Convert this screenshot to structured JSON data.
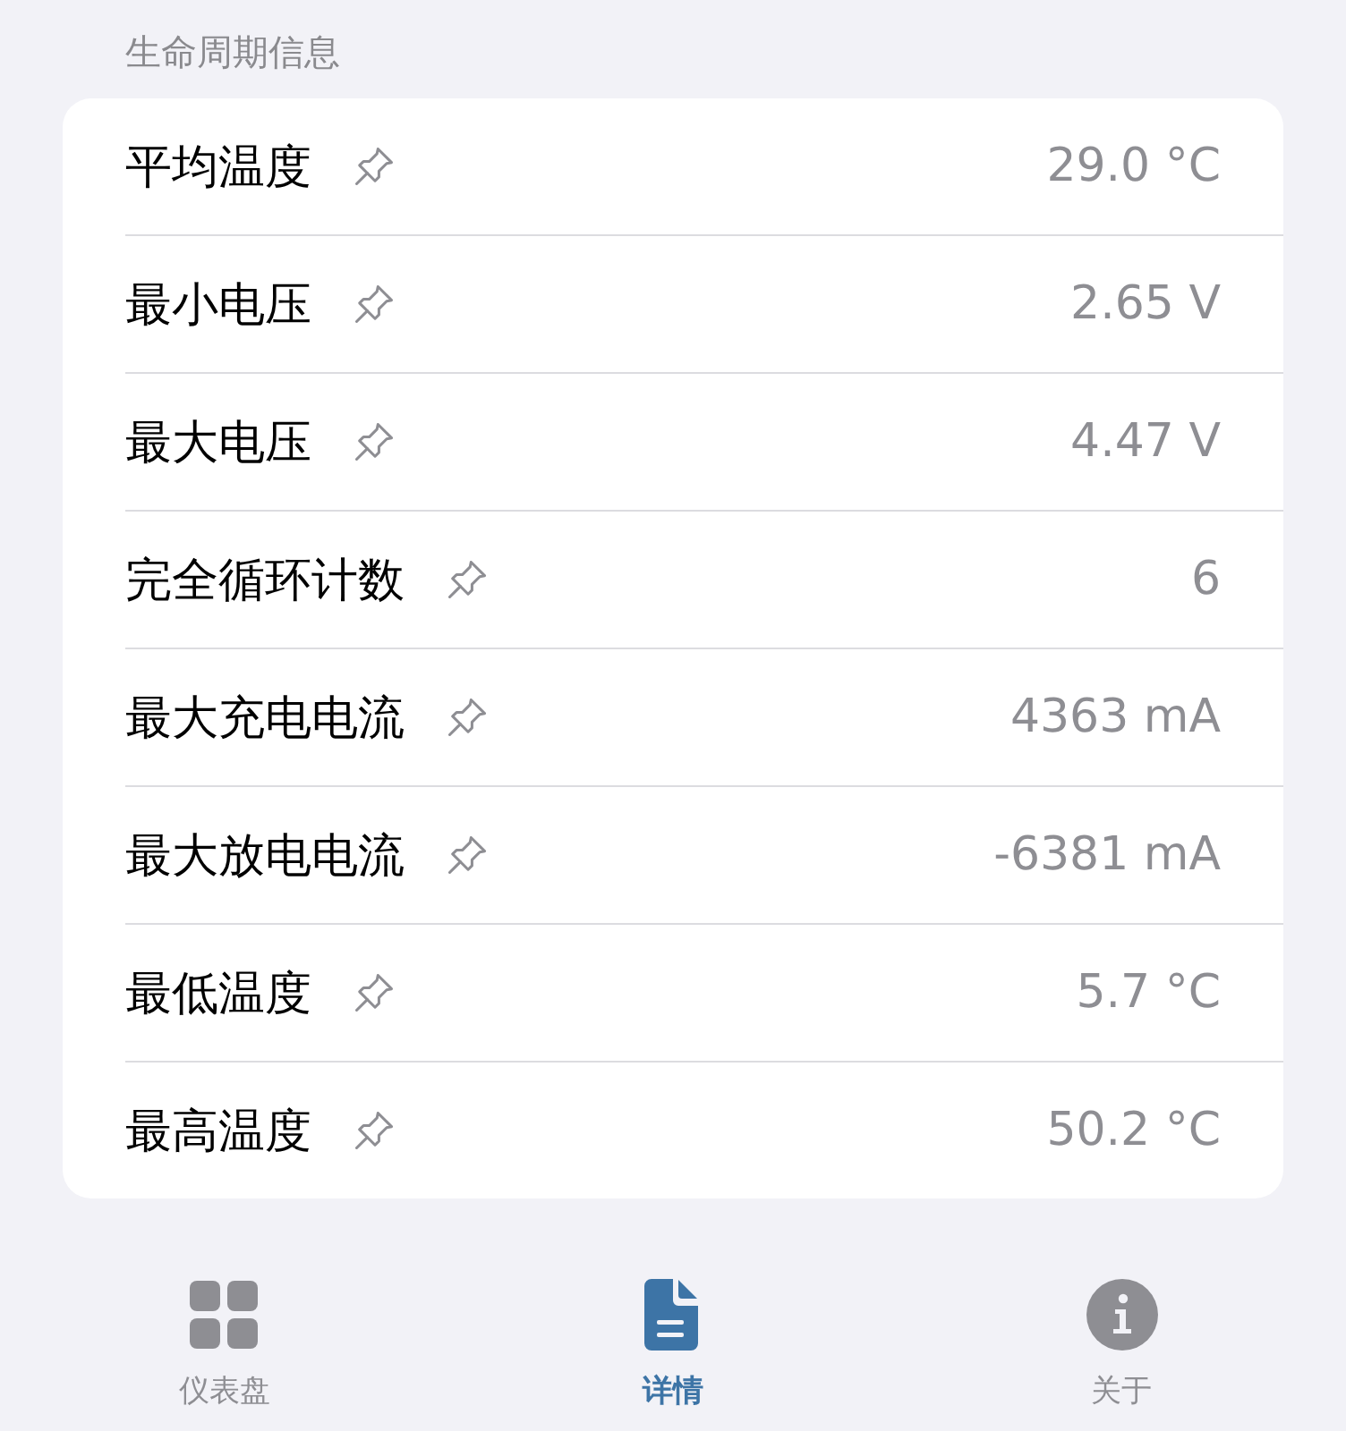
{
  "section_title": "生命周期信息",
  "rows": [
    {
      "label": "平均温度",
      "value": "29.0 °C"
    },
    {
      "label": "最小电压",
      "value": "2.65 V"
    },
    {
      "label": "最大电压",
      "value": "4.47 V"
    },
    {
      "label": "完全循环计数",
      "value": "6"
    },
    {
      "label": "最大充电电流",
      "value": "4363 mA"
    },
    {
      "label": "最大放电电流",
      "value": "-6381 mA"
    },
    {
      "label": "最低温度",
      "value": "5.7 °C"
    },
    {
      "label": "最高温度",
      "value": "50.2 °C"
    }
  ],
  "tabs": [
    {
      "kind": "grid",
      "label": "仪表盘",
      "selected": false
    },
    {
      "kind": "document",
      "label": "详情",
      "selected": true
    },
    {
      "kind": "info",
      "label": "关于",
      "selected": false
    }
  ]
}
